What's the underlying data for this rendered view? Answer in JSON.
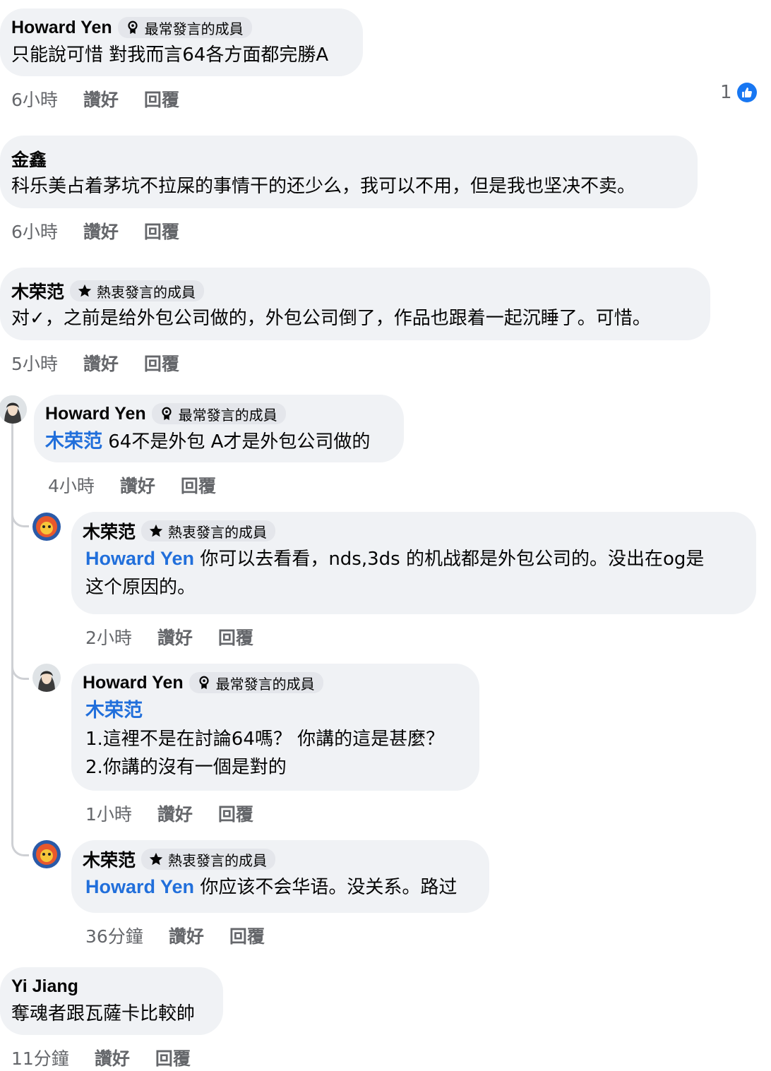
{
  "actions": {
    "like": "讚好",
    "reply": "回覆"
  },
  "comments": [
    {
      "author": "Howard Yen",
      "badge": "最常發言的成員",
      "badge_icon": "top-contributor-icon",
      "lines": [
        "只能說可惜 對我而言64各方面都完勝A"
      ],
      "time": "6小時",
      "reactions": {
        "count": "1",
        "icon": "like-icon"
      }
    },
    {
      "author": "金鑫",
      "lines": [
        "科乐美占着茅坑不拉屎的事情干的还少么，我可以不用，但是我也坚决不卖。"
      ],
      "time": "6小時"
    },
    {
      "author": "木荣范",
      "badge": "熱衷發言的成員",
      "badge_icon": "star-icon",
      "lines": [
        "对✓，之前是给外包公司做的，外包公司倒了，作品也跟着一起沉睡了。可惜。"
      ],
      "time": "5小時",
      "replies": [
        {
          "author": "Howard Yen",
          "badge": "最常發言的成員",
          "mention": "木荣范",
          "lines": [
            " 64不是外包 A才是外包公司做的"
          ],
          "time": "4小時",
          "replies": [
            {
              "author": "木荣范",
              "badge": "熱衷發言的成員",
              "mention": "Howard Yen",
              "lines": [
                " 你可以去看看，nds,3ds 的机战都是外包公司的。没出在og是",
                "这个原因的。"
              ],
              "time": "2小時"
            },
            {
              "author": "Howard Yen",
              "badge": "最常發言的成員",
              "mention": "木荣范",
              "lines": [
                "1.這裡不是在討論64嗎？ 你講的這是甚麼？",
                "2.你講的沒有一個是對的"
              ],
              "time": "1小時"
            },
            {
              "author": "木荣范",
              "badge": "熱衷發言的成員",
              "mention": "Howard Yen",
              "lines": [
                " 你应该不会华语。没关系。路过"
              ],
              "time": "36分鐘"
            }
          ]
        }
      ]
    },
    {
      "author": "Yi Jiang",
      "lines": [
        "奪魂者跟瓦薩卡比較帥"
      ],
      "time": "11分鐘"
    }
  ],
  "colors": {
    "bubble": "#f0f2f5",
    "mention": "#216fdb",
    "meta": "#65676b",
    "like": "#1877f2"
  }
}
